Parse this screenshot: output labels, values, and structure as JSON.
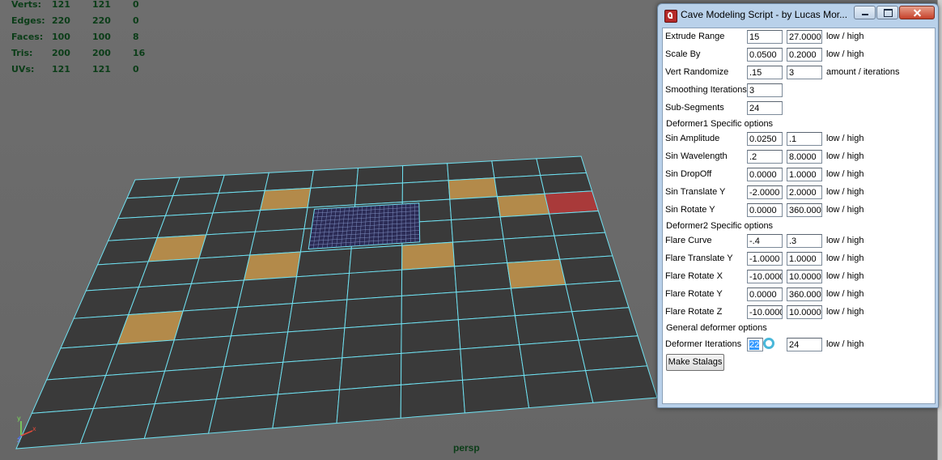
{
  "hud": {
    "rows": [
      {
        "label": "Verts:",
        "v1": "121",
        "v2": "121",
        "v3": "0"
      },
      {
        "label": "Edges:",
        "v1": "220",
        "v2": "220",
        "v3": "0"
      },
      {
        "label": "Faces:",
        "v1": "100",
        "v2": "100",
        "v3": "8"
      },
      {
        "label": "Tris:",
        "v1": "200",
        "v2": "200",
        "v3": "16"
      },
      {
        "label": "UVs:",
        "v1": "121",
        "v2": "121",
        "v3": "0"
      }
    ]
  },
  "viewport": {
    "camera_label": "persp",
    "grid_color": "#6fe0f0",
    "face_color": "#3a3a3a",
    "selected_face_color": "#b38a4a",
    "highlight_face_color": "#a93a3a",
    "subdivided_color": "#2b2b55"
  },
  "dialog": {
    "title": "Cave Modeling Script - by Lucas Mor...",
    "rows": [
      {
        "label": "Extrude Range",
        "v1": "15",
        "v2": "27.0000",
        "suffix": "low / high"
      },
      {
        "label": "Scale By",
        "v1": "0.0500",
        "v2": "0.2000",
        "suffix": "low / high"
      },
      {
        "label": "Vert Randomize",
        "v1": ".15",
        "v2": "3",
        "suffix": "amount / iterations"
      },
      {
        "label": "Smoothing Iterations",
        "v1": "3"
      },
      {
        "label": "Sub-Segments",
        "v1": "24"
      }
    ],
    "section1": "Deformer1 Specific options",
    "rows1": [
      {
        "label": "Sin Amplitude",
        "v1": "0.0250",
        "v2": ".1",
        "suffix": "low / high"
      },
      {
        "label": "Sin Wavelength",
        "v1": ".2",
        "v2": "8.0000",
        "suffix": "low / high"
      },
      {
        "label": "Sin DropOff",
        "v1": "0.0000",
        "v2": "1.0000",
        "suffix": "low / high"
      },
      {
        "label": "Sin Translate Y",
        "v1": "-2.0000",
        "v2": "2.0000",
        "suffix": "low / high"
      },
      {
        "label": "Sin Rotate Y",
        "v1": "0.0000",
        "v2": "360.0000",
        "suffix": "low / high"
      }
    ],
    "section2": "Deformer2 Specific options",
    "rows2": [
      {
        "label": "Flare Curve",
        "v1": "-.4",
        "v2": ".3",
        "suffix": "low / high"
      },
      {
        "label": "Flare Translate Y",
        "v1": "-1.0000",
        "v2": "1.0000",
        "suffix": "low / high"
      },
      {
        "label": "Flare Rotate X",
        "v1": "-10.0000",
        "v2": "10.0000",
        "suffix": "low / high"
      },
      {
        "label": "Flare Rotate Y",
        "v1": "0.0000",
        "v2": "360.0000",
        "suffix": "low / high"
      },
      {
        "label": "Flare Rotate Z",
        "v1": "-10.0000",
        "v2": "10.0000",
        "suffix": "low / high"
      }
    ],
    "section3": "General deformer options",
    "iter_row": {
      "label": "Deformer Iterations",
      "v1": "22",
      "v2": "24",
      "suffix": "low / high"
    },
    "button": "Make Stalags"
  }
}
